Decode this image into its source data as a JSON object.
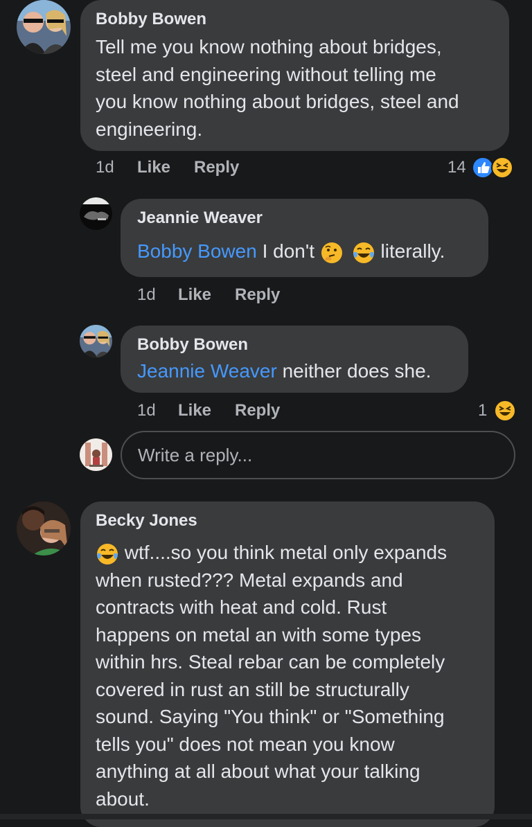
{
  "comments": [
    {
      "author": "Bobby Bowen",
      "lines": [
        "Tell me you know nothing about bridges,",
        "steel and engineering without telling me",
        "you know nothing about bridges, steel and",
        "engineering."
      ],
      "time": "1d",
      "like": "Like",
      "reply": "Reply",
      "reaction_count": "14",
      "reactions": [
        "like-reaction-icon",
        "haha-reaction-icon"
      ]
    },
    {
      "author": "Jeannie Weaver",
      "mention": "Bobby Bowen",
      "text_a": " I don't ",
      "emoji_1": "thinking-face-icon",
      "emoji_2": "laughing-tears-icon",
      "text_b": " literally.",
      "time": "1d",
      "like": "Like",
      "reply": "Reply"
    },
    {
      "author": "Bobby Bowen",
      "mention": "Jeannie Weaver",
      "text": " neither does she.",
      "time": "1d",
      "like": "Like",
      "reply": "Reply",
      "reaction_count": "1",
      "reactions": [
        "haha-reaction-icon"
      ]
    },
    {
      "author": "Becky Jones",
      "first_line_emoji": "laughing-tears-icon",
      "lines": [
        " wtf....so you think metal only expands",
        "when rusted??? Metal expands and",
        "contracts with heat and cold. Rust",
        "happens on metal an with some types",
        "within hrs. Steal rebar can be completely",
        "covered in rust an still be structurally",
        "sound. Saying \"You think\" or \"Something",
        "tells you\" does not mean you know",
        "anything at all about what your talking",
        "about."
      ]
    }
  ],
  "reply_input": {
    "placeholder": "Write a reply..."
  },
  "colors": {
    "background": "#18191a",
    "bubble": "#3a3b3c",
    "mention": "#4599ff",
    "secondary_text": "#b0b3b8",
    "like_blue": "#2d88ff",
    "haha_yellow": "#f7b928"
  }
}
